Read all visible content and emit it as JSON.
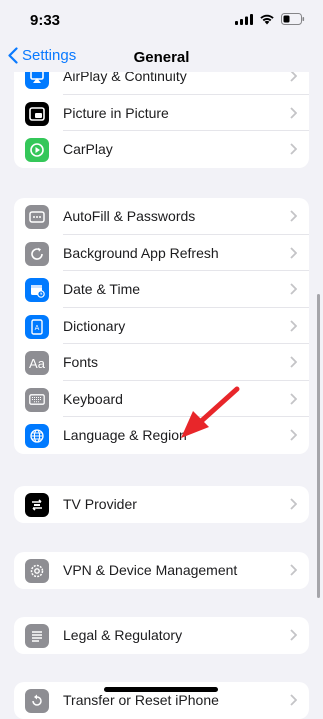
{
  "status_bar": {
    "time": "9:33"
  },
  "nav": {
    "back_label": "Settings",
    "title": "General"
  },
  "groups": [
    {
      "id": "airplay-group",
      "rows": [
        {
          "label": "AirPlay & Continuity",
          "icon": "airplay-icon",
          "color": "#007aff"
        },
        {
          "label": "Picture in Picture",
          "icon": "picture-in-picture-icon",
          "color": "#000000"
        },
        {
          "label": "CarPlay",
          "icon": "carplay-icon",
          "color": "#34c759"
        }
      ]
    },
    {
      "id": "system-group",
      "rows": [
        {
          "label": "AutoFill & Passwords",
          "icon": "autofill-icon",
          "color": "#8e8e93"
        },
        {
          "label": "Background App Refresh",
          "icon": "background-refresh-icon",
          "color": "#8e8e93"
        },
        {
          "label": "Date & Time",
          "icon": "calendar-clock-icon",
          "color": "#007aff"
        },
        {
          "label": "Dictionary",
          "icon": "dictionary-icon",
          "color": "#007aff"
        },
        {
          "label": "Fonts",
          "icon": "fonts-icon",
          "color": "#8e8e93"
        },
        {
          "label": "Keyboard",
          "icon": "keyboard-icon",
          "color": "#8e8e93"
        },
        {
          "label": "Language & Region",
          "icon": "globe-icon",
          "color": "#007aff"
        }
      ]
    },
    {
      "id": "tv-group",
      "rows": [
        {
          "label": "TV Provider",
          "icon": "tv-provider-icon",
          "color": "#000000"
        }
      ]
    },
    {
      "id": "vpn-group",
      "rows": [
        {
          "label": "VPN & Device Management",
          "icon": "gear-icon",
          "color": "#8e8e93"
        }
      ]
    },
    {
      "id": "legal-group",
      "rows": [
        {
          "label": "Legal & Regulatory",
          "icon": "document-icon",
          "color": "#8e8e93"
        }
      ]
    },
    {
      "id": "transfer-group",
      "rows": [
        {
          "label": "Transfer or Reset iPhone",
          "icon": "reset-icon",
          "color": "#8e8e93"
        }
      ]
    }
  ],
  "annotation": {
    "arrow_color": "#e8262a"
  }
}
